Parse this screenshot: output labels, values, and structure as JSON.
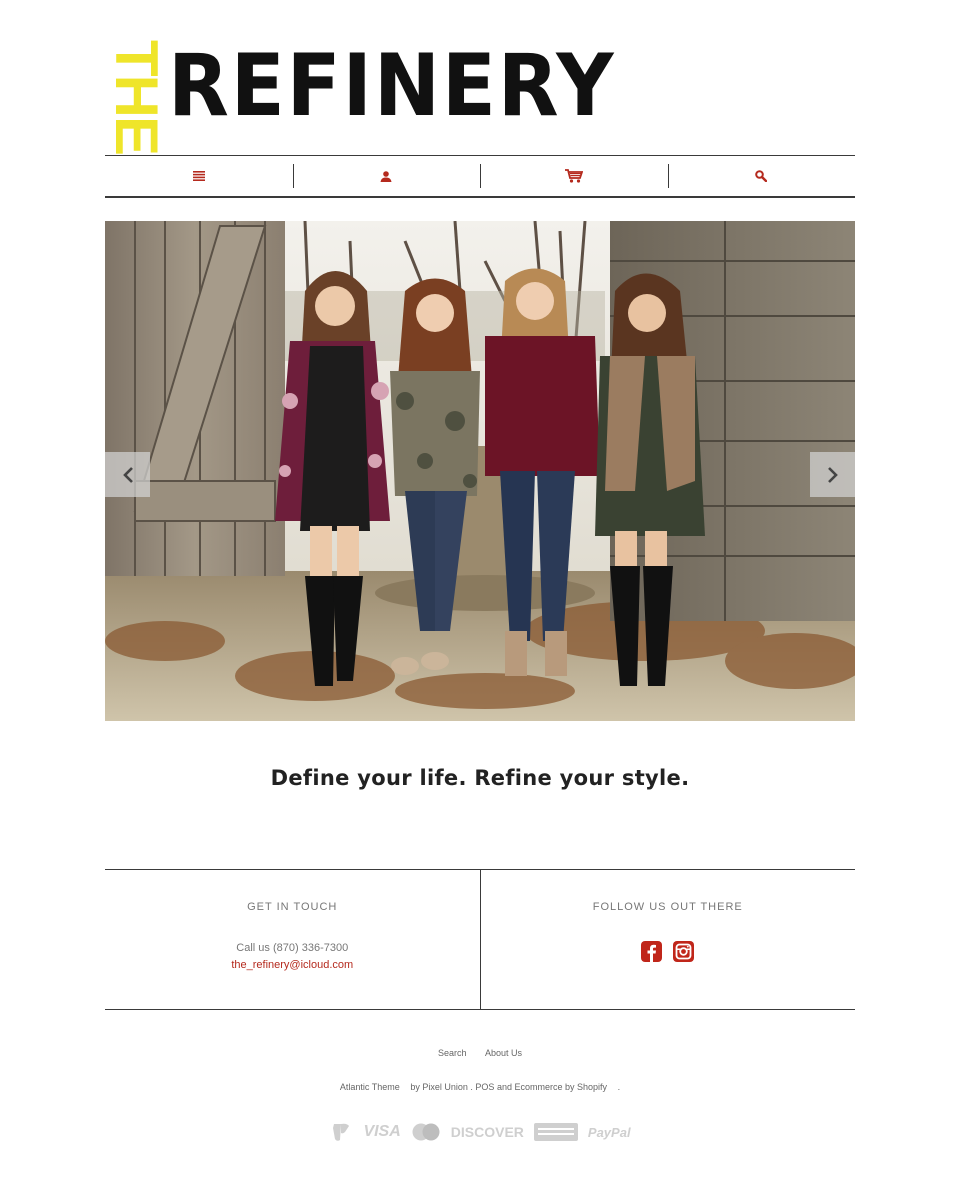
{
  "brand": {
    "logo_prefix": "THE",
    "logo_name": "REFINERY",
    "logo_prefix_color": "#efe52a",
    "logo_name_color": "#111111"
  },
  "nav": {
    "accent_color": "#b52a1e",
    "items": [
      {
        "icon": "menu-icon"
      },
      {
        "icon": "account-icon"
      },
      {
        "icon": "cart-icon"
      },
      {
        "icon": "search-icon"
      }
    ]
  },
  "hero": {
    "prev_icon": "chevron-left-icon",
    "next_icon": "chevron-right-icon"
  },
  "tagline": "Define your life. Refine your style.",
  "contact": {
    "heading": "GET IN TOUCH",
    "phone": "Call us (870) 336-7300",
    "email": "the_refinery@icloud.com"
  },
  "social": {
    "heading": "FOLLOW US OUT THERE",
    "icons": [
      "facebook-icon",
      "instagram-icon"
    ]
  },
  "footer": {
    "links": [
      "Search",
      "About Us"
    ],
    "credits": {
      "theme": "Atlantic Theme",
      "by": "by",
      "maker": "Pixel Union",
      "dot1": ".",
      "pos": "POS",
      "and": "and",
      "ecommerce": "Ecommerce by Shopify",
      "dot2": "."
    },
    "payment_methods": [
      "Venmo",
      "VISA",
      "Mastercard",
      "DISCOVER",
      "American Express",
      "PayPal"
    ]
  }
}
